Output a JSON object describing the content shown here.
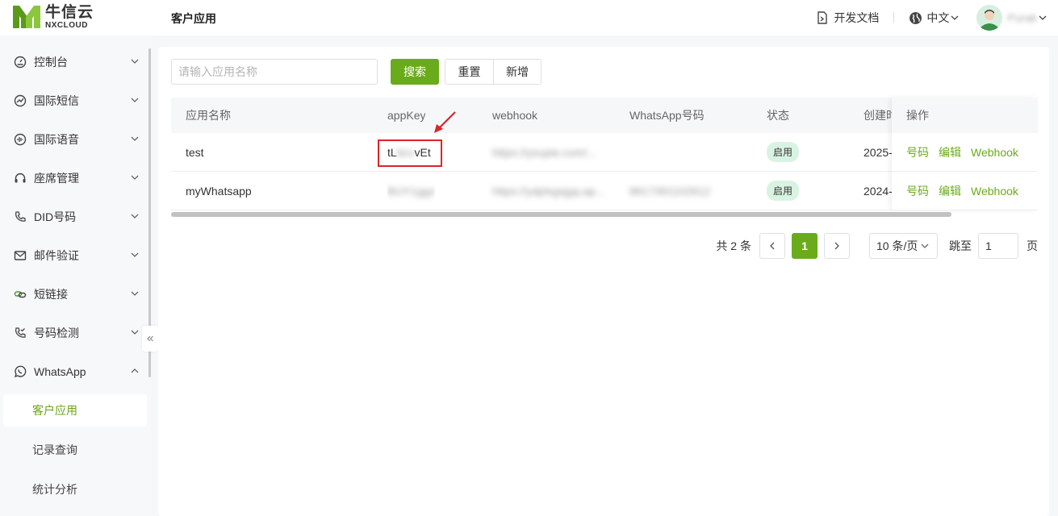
{
  "brand": {
    "name_cn": "牛信云",
    "name_en": "NXCLOUD",
    "accent": "#6aab1b"
  },
  "header": {
    "page_title": "客户应用",
    "docs_label": "开发文档",
    "lang_label": "中文",
    "user_name": "Purak"
  },
  "sidebar": {
    "items": [
      {
        "label": "控制台",
        "icon": "dashboard-icon"
      },
      {
        "label": "国际短信",
        "icon": "sms-icon"
      },
      {
        "label": "国际语音",
        "icon": "voice-icon"
      },
      {
        "label": "座席管理",
        "icon": "headset-icon"
      },
      {
        "label": "DID号码",
        "icon": "phone-icon"
      },
      {
        "label": "邮件验证",
        "icon": "mail-icon"
      },
      {
        "label": "短链接",
        "icon": "link-icon"
      },
      {
        "label": "号码检测",
        "icon": "phone-check-icon"
      },
      {
        "label": "WhatsApp",
        "icon": "whatsapp-icon"
      }
    ],
    "sub_items": [
      {
        "label": "客户应用",
        "active": true
      },
      {
        "label": "记录查询",
        "active": false
      },
      {
        "label": "统计分析",
        "active": false
      }
    ]
  },
  "toolbar": {
    "search_placeholder": "请输入应用名称",
    "search_label": "搜索",
    "reset_label": "重置",
    "add_label": "新增"
  },
  "table": {
    "columns": [
      "应用名称",
      "appKey",
      "webhook",
      "WhatsApp号码",
      "状态",
      "创建时",
      "操作"
    ],
    "rows": [
      {
        "name": "test",
        "appkey_start": "tL",
        "appkey_mid": "bcv",
        "appkey_end": "vEt",
        "webhook": "https://youpie.com/...",
        "number": "",
        "status": "启用",
        "created": "2025-"
      },
      {
        "name": "myWhatsapp",
        "appkey_start": "",
        "appkey_mid": "BUY1ggz",
        "appkey_end": "",
        "webhook": "https://ydplsgsjgq.ap...",
        "number": "8617391102612",
        "status": "启用",
        "created": "2024-"
      }
    ],
    "actions": [
      "号码",
      "编辑",
      "Webhook"
    ]
  },
  "pagination": {
    "total_text": "共 2 条",
    "current_page": "1",
    "page_size": "10 条/页",
    "jump_label": "跳至",
    "jump_value": "1",
    "page_suffix": "页"
  }
}
